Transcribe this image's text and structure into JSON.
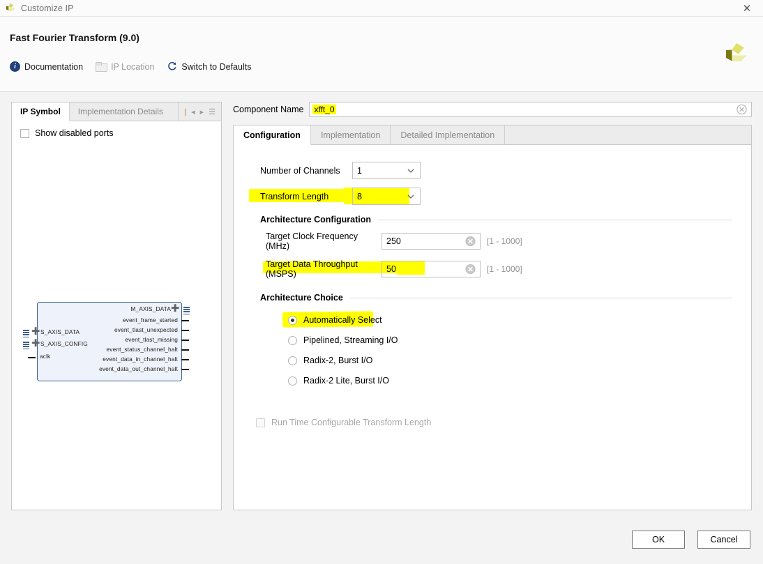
{
  "window": {
    "title": "Customize IP",
    "close_label": "✕",
    "app_icon": "xilinx-logo-icon"
  },
  "header": {
    "title": "Fast Fourier Transform (9.0)",
    "links": [
      {
        "label": "Documentation",
        "icon": "info-icon",
        "disabled": false
      },
      {
        "label": "IP Location",
        "icon": "folder-icon",
        "disabled": true
      },
      {
        "label": "Switch to Defaults",
        "icon": "refresh-icon",
        "disabled": false
      }
    ],
    "brand_icon": "xilinx-logo-icon"
  },
  "left_panel": {
    "tabs": [
      {
        "label": "IP Symbol",
        "active": true
      },
      {
        "label": "Implementation Details",
        "active": false
      }
    ],
    "nav_icons": [
      "bar-icon",
      "prev-arrow-icon",
      "next-arrow-icon",
      "menu-icon"
    ],
    "show_disabled_ports": {
      "label": "Show disabled ports",
      "checked": false
    },
    "symbol": {
      "left_ports": [
        {
          "name": "S_AXIS_DATA",
          "type": "bus"
        },
        {
          "name": "S_AXIS_CONFIG",
          "type": "bus"
        },
        {
          "name": "aclk",
          "type": "pin"
        }
      ],
      "right_ports": [
        {
          "name": "M_AXIS_DATA",
          "type": "bus"
        },
        {
          "name": "event_frame_started",
          "type": "pin"
        },
        {
          "name": "event_tlast_unexpected",
          "type": "pin"
        },
        {
          "name": "event_tlast_missing",
          "type": "pin"
        },
        {
          "name": "event_status_channel_halt",
          "type": "pin"
        },
        {
          "name": "event_data_in_channel_halt",
          "type": "pin"
        },
        {
          "name": "event_data_out_channel_halt",
          "type": "pin"
        }
      ]
    }
  },
  "component": {
    "label": "Component Name",
    "value": "xfft_0",
    "clear_icon": "clear-circle-icon",
    "highlighted": true
  },
  "tabs": [
    {
      "label": "Configuration",
      "active": true
    },
    {
      "label": "Implementation",
      "active": false
    },
    {
      "label": "Detailed Implementation",
      "active": false
    }
  ],
  "configuration": {
    "number_of_channels": {
      "label": "Number of Channels",
      "value": "1",
      "highlighted": false
    },
    "transform_length": {
      "label": "Transform Length",
      "value": "8",
      "highlighted": true
    },
    "architecture_configuration": {
      "title": "Architecture Configuration",
      "target_clock_frequency": {
        "label": "Target Clock Frequency (MHz)",
        "value": "250",
        "range": "[1 - 1000]",
        "highlighted": false
      },
      "target_data_throughput": {
        "label": "Target Data Throughput (MSPS)",
        "value": "50",
        "range": "[1 - 1000]",
        "highlighted": true
      }
    },
    "architecture_choice": {
      "title": "Architecture Choice",
      "options": [
        {
          "label": "Automatically Select",
          "selected": true,
          "highlighted": true
        },
        {
          "label": "Pipelined, Streaming I/O",
          "selected": false,
          "highlighted": false
        },
        {
          "label": "Radix-2, Burst I/O",
          "selected": false,
          "highlighted": false
        },
        {
          "label": "Radix-2 Lite, Burst I/O",
          "selected": false,
          "highlighted": false
        }
      ]
    },
    "run_time_configurable": {
      "label": "Run Time Configurable Transform Length",
      "checked": false,
      "disabled": true
    }
  },
  "footer": {
    "ok_label": "OK",
    "cancel_label": "Cancel"
  },
  "colors": {
    "highlight": "#ffff00",
    "accent_blue": "#22417a",
    "symbol_fill": "#eef2fa",
    "symbol_border": "#3f5f92",
    "brand_olive": "#a8a81e"
  }
}
